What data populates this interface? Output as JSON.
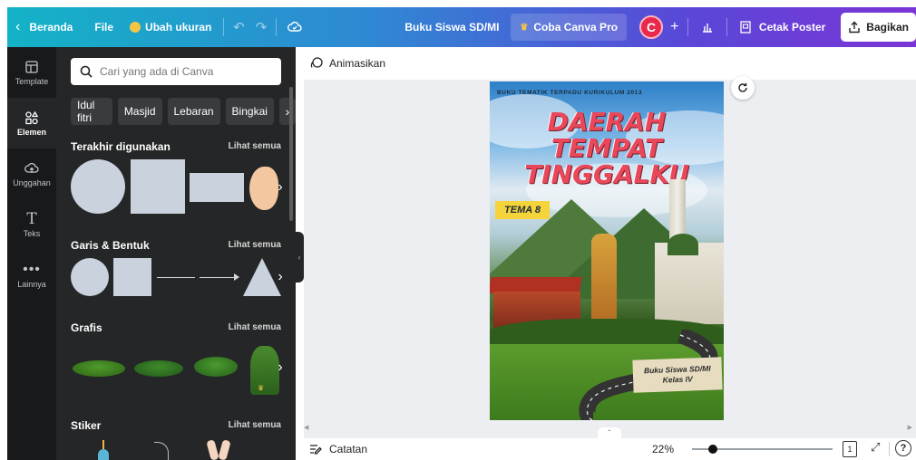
{
  "topbar": {
    "back_label": "Beranda",
    "file_label": "File",
    "resize_label": "Ubah ukuran",
    "doc_title": "Buku Siswa SD/MI",
    "try_pro_label": "Coba Canva Pro",
    "avatar_letter": "C",
    "print_label": "Cetak Poster",
    "share_label": "Bagikan"
  },
  "rail": [
    {
      "label": "Template",
      "icon": "template-icon"
    },
    {
      "label": "Elemen",
      "icon": "elements-icon"
    },
    {
      "label": "Unggahan",
      "icon": "upload-icon"
    },
    {
      "label": "Teks",
      "icon": "text-icon"
    },
    {
      "label": "Lainnya",
      "icon": "more-icon"
    }
  ],
  "panel": {
    "search_placeholder": "Cari yang ada di Canva",
    "chips": [
      "Idul fitri",
      "Masjid",
      "Lebaran",
      "Bingkai"
    ],
    "see_all": "Lihat semua",
    "sections": [
      "Terakhir digunakan",
      "Garis & Bentuk",
      "Grafis",
      "Stiker"
    ]
  },
  "canvas": {
    "animate_label": "Animasikan",
    "notes_label": "Catatan",
    "zoom": "22%",
    "page_number": "1",
    "zoom_fraction": 0.15
  },
  "poster": {
    "header": "BUKU TEMATIK TERPADU KURIKULUM 2013",
    "title_1": "DAERAH",
    "title_2": "TEMPAT",
    "title_3": "TINGGALKU",
    "theme": "TEMA 8",
    "book_1": "Buku Siswa SD/MI",
    "book_2": "Kelas IV"
  },
  "colors": {
    "accent_title": "#e8485a",
    "theme_badge": "#f5d33a",
    "panel_bg": "#252627"
  }
}
